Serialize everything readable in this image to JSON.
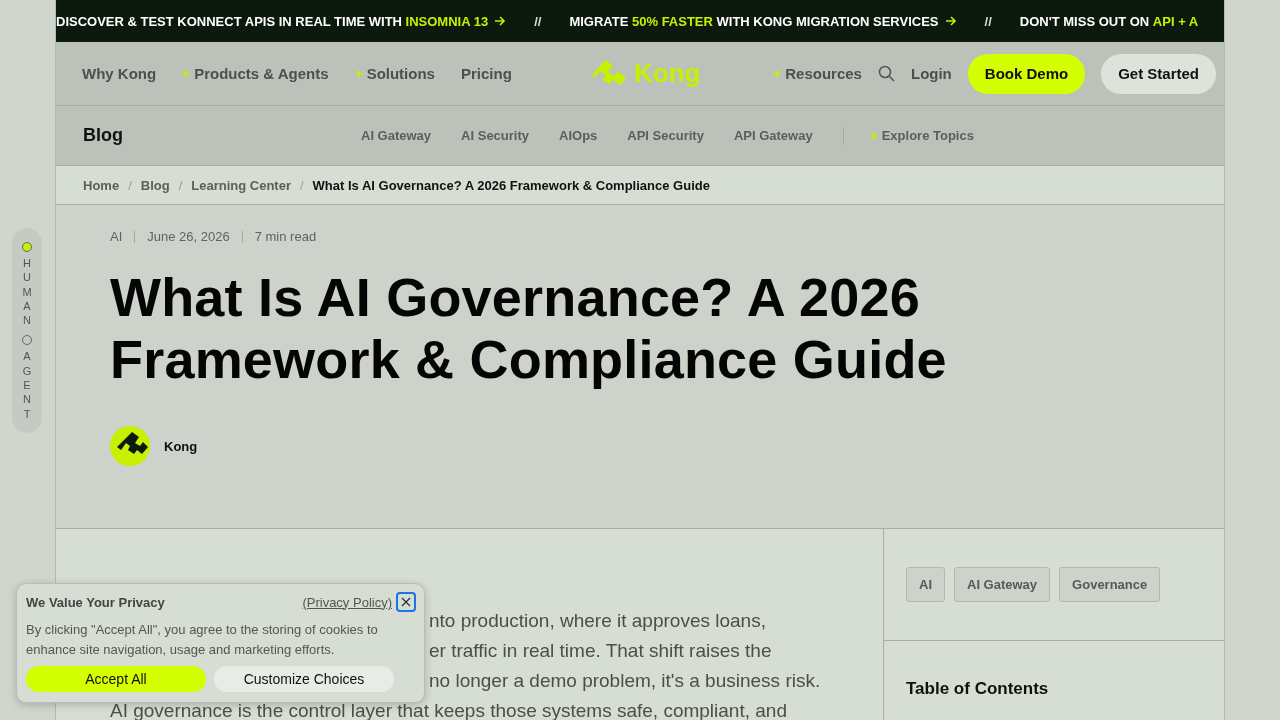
{
  "ticker": [
    {
      "kind": "item",
      "parts": [
        {
          "text": "DISCOVER & TEST KONNECT APIS IN REAL TIME WITH ",
          "highlight": false
        },
        {
          "text": "INSOMNIA 13",
          "highlight": true
        }
      ],
      "arrow": true
    },
    {
      "kind": "separator",
      "text": "//"
    },
    {
      "kind": "item",
      "parts": [
        {
          "text": "MIGRATE ",
          "highlight": false
        },
        {
          "text": "50% FASTER",
          "highlight": true
        },
        {
          "text": " WITH KONG MIGRATION SERVICES",
          "highlight": false
        }
      ],
      "arrow": true
    },
    {
      "kind": "separator",
      "text": "//"
    },
    {
      "kind": "item",
      "parts": [
        {
          "text": "DON'T MISS OUT ON ",
          "highlight": false
        },
        {
          "text": "API + A",
          "highlight": true
        }
      ],
      "arrow": false
    }
  ],
  "nav": {
    "left": [
      {
        "label": "Why Kong",
        "plus": false
      },
      {
        "label": "Products & Agents",
        "plus": true
      },
      {
        "label": "Solutions",
        "plus": true
      },
      {
        "label": "Pricing",
        "plus": false
      }
    ],
    "logo": "Kong",
    "right": [
      {
        "label": "Resources",
        "plus": true
      }
    ],
    "login": "Login",
    "book_demo": "Book Demo",
    "get_started": "Get Started"
  },
  "subnav": {
    "title": "Blog",
    "links": [
      "AI Gateway",
      "AI Security",
      "AIOps",
      "API Security",
      "API Gateway"
    ],
    "explore": "Explore Topics"
  },
  "breadcrumb": {
    "separator": "/",
    "items": [
      "Home",
      "Blog",
      "Learning Center",
      "What Is AI Governance? A 2026 Framework & Compliance Guide"
    ]
  },
  "mode_toggle": [
    {
      "label": "HUMAN",
      "selected": true
    },
    {
      "label": "AGENT",
      "selected": false
    }
  ],
  "article": {
    "meta": [
      "AI",
      "June 26, 2026",
      "7 min read"
    ],
    "title": "What Is AI Governance? A 2026 Framework & Compliance Guide",
    "author": "Kong",
    "body": [
      {
        "kind": "partial",
        "text": "nto production, where it approves loans,"
      },
      {
        "kind": "partial",
        "text": "er traffic in real time. That shift raises the"
      },
      {
        "kind": "partial",
        "text": "no longer a demo problem, it's a business risk."
      },
      {
        "kind": "full",
        "text": "AI governance is the control layer that keeps those systems safe, compliant, and"
      }
    ]
  },
  "sidebar": {
    "tags": [
      "AI",
      "AI Gateway",
      "Governance"
    ],
    "toc_title": "Table of Contents"
  },
  "cookie_banner": {
    "title": "We Value Your Privacy",
    "policy_link": "(Privacy Policy)",
    "text": "By clicking \"Accept All\", you agree to the storing of cookies to enhance site navigation, usage and marketing efforts.",
    "accept": "Accept All",
    "customize": "Customize Choices"
  }
}
